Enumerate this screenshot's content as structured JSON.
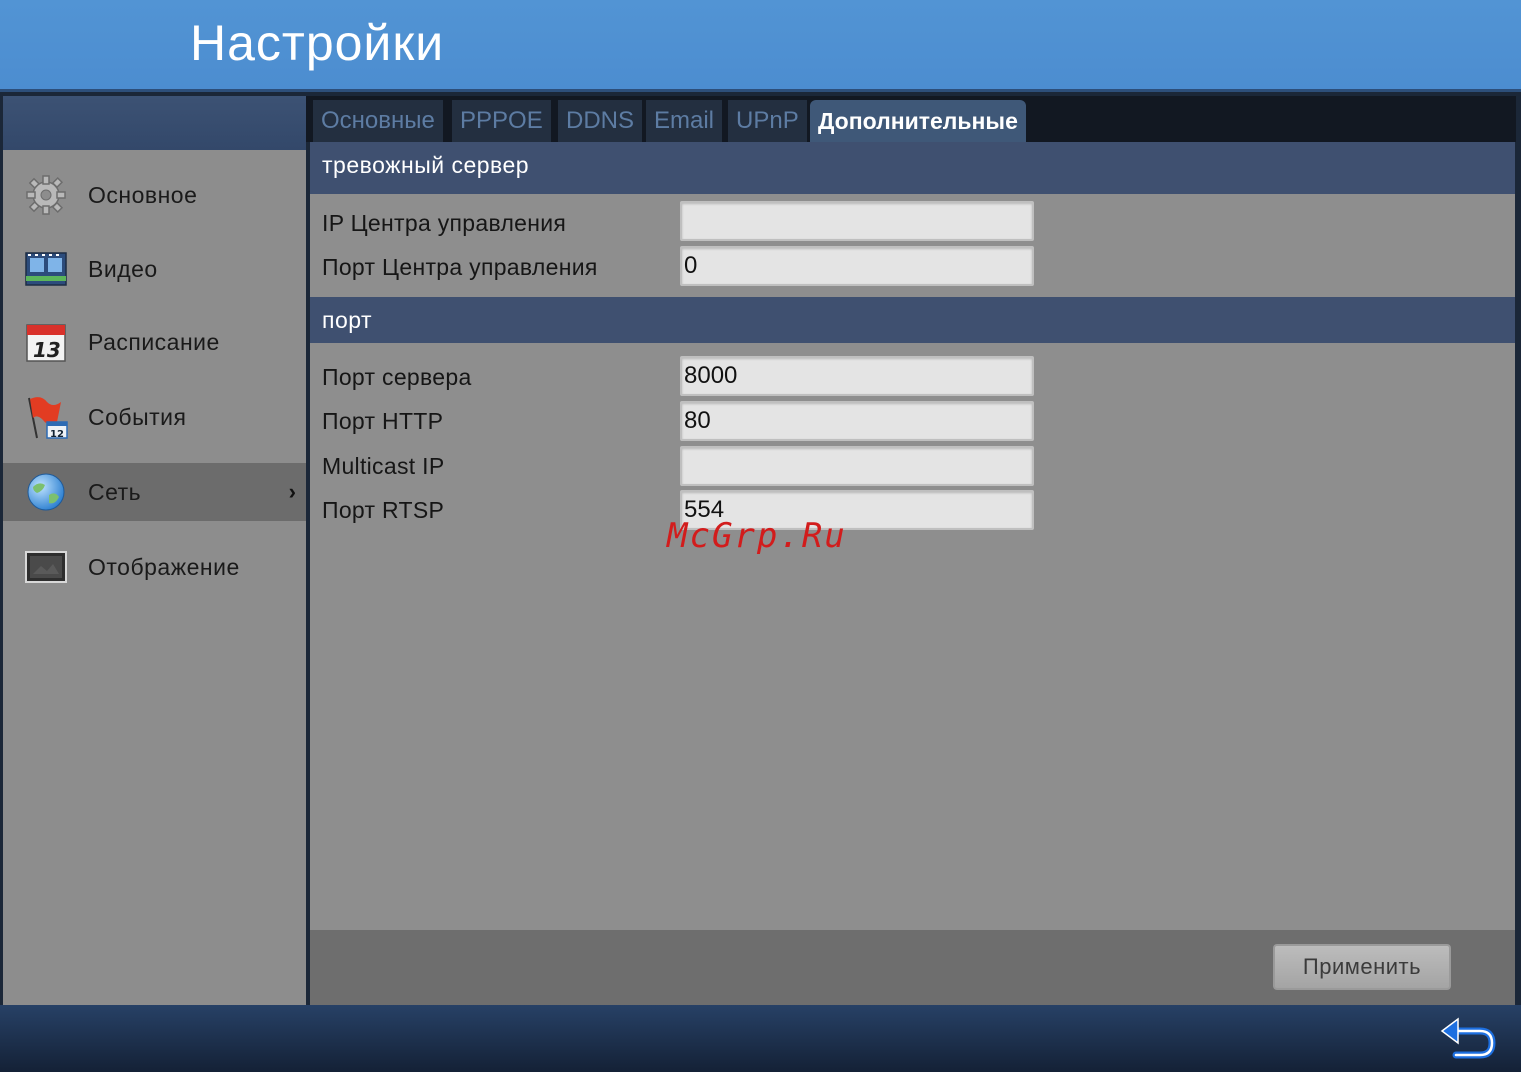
{
  "window": {
    "title": "Настройки"
  },
  "sidebar": {
    "items": [
      {
        "label": "Основное",
        "icon": "gear-icon",
        "active": false
      },
      {
        "label": "Видео",
        "icon": "video-film-icon",
        "active": false
      },
      {
        "label": "Расписание",
        "icon": "calendar-icon",
        "active": false
      },
      {
        "label": "События",
        "icon": "flag-calendar-icon",
        "active": false
      },
      {
        "label": "Сеть",
        "icon": "globe-icon",
        "active": true,
        "chevron": "›"
      },
      {
        "label": "Отображение",
        "icon": "monitor-icon",
        "active": false
      }
    ]
  },
  "tabs": [
    {
      "label": "Основные",
      "active": false
    },
    {
      "label": "PPPOE",
      "active": false
    },
    {
      "label": "DDNS",
      "active": false
    },
    {
      "label": "Email",
      "active": false
    },
    {
      "label": "UPnP",
      "active": false
    },
    {
      "label": "Дополнительные",
      "active": true
    }
  ],
  "sections": {
    "alarm_server": {
      "title": "тревожный сервер",
      "fields": [
        {
          "label": "IP Центра управления",
          "value": ""
        },
        {
          "label": "Порт Центра управления",
          "value": "0"
        }
      ]
    },
    "port": {
      "title": "порт",
      "fields": [
        {
          "label": "Порт сервера",
          "value": "8000"
        },
        {
          "label": "Порт HTTP",
          "value": "80"
        },
        {
          "label": "Multicast IP",
          "value": ""
        },
        {
          "label": "Порт RTSP",
          "value": "554"
        }
      ]
    }
  },
  "footer": {
    "apply_label": "Применить"
  },
  "bottom": {
    "back_icon": "back-arrow-icon"
  },
  "watermark": "McGrp.Ru",
  "colors": {
    "title_bar": "#4c8dd0",
    "section_header": "#3f5070",
    "content_bg": "#8e8e8e",
    "active_tab": "#3f5878"
  }
}
